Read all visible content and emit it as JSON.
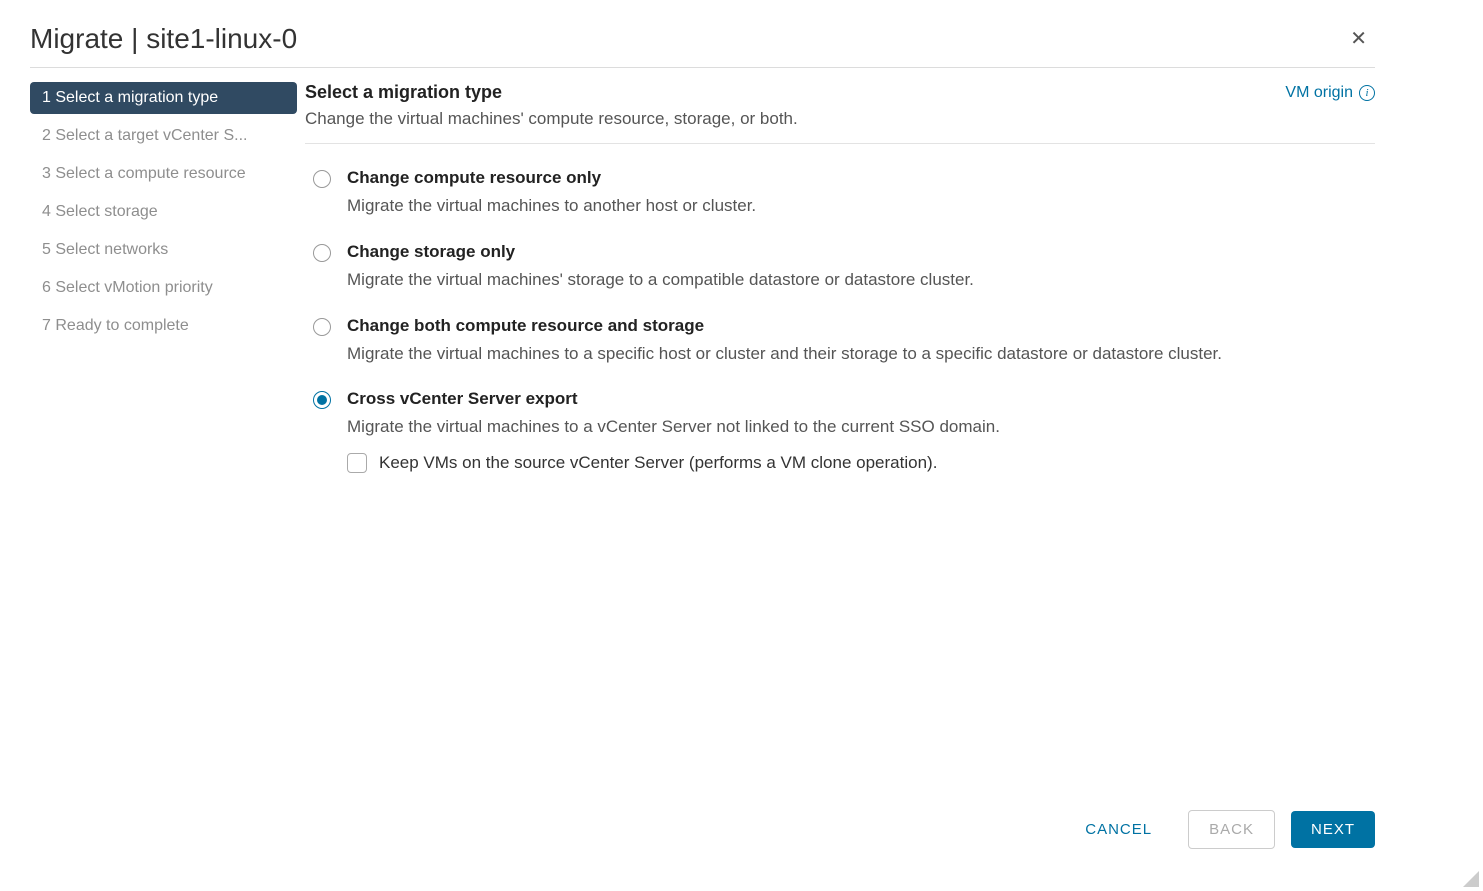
{
  "dialog": {
    "title": "Migrate | site1-linux-0"
  },
  "sidebar": {
    "steps": [
      {
        "num": "1",
        "label": "Select a migration type",
        "active": true
      },
      {
        "num": "2",
        "label": "Select a target vCenter S...",
        "active": false
      },
      {
        "num": "3",
        "label": "Select a compute resource",
        "active": false
      },
      {
        "num": "4",
        "label": "Select storage",
        "active": false
      },
      {
        "num": "5",
        "label": "Select networks",
        "active": false
      },
      {
        "num": "6",
        "label": "Select vMotion priority",
        "active": false
      },
      {
        "num": "7",
        "label": "Ready to complete",
        "active": false
      }
    ]
  },
  "main": {
    "title": "Select a migration type",
    "subtitle": "Change the virtual machines' compute resource, storage, or both.",
    "vm_origin_label": "VM origin"
  },
  "options": [
    {
      "title": "Change compute resource only",
      "desc": "Migrate the virtual machines to another host or cluster.",
      "selected": false
    },
    {
      "title": "Change storage only",
      "desc": "Migrate the virtual machines' storage to a compatible datastore or datastore cluster.",
      "selected": false
    },
    {
      "title": "Change both compute resource and storage",
      "desc": "Migrate the virtual machines to a specific host or cluster and their storage to a specific datastore or datastore cluster.",
      "selected": false
    },
    {
      "title": "Cross vCenter Server export",
      "desc": "Migrate the virtual machines to a vCenter Server not linked to the current SSO domain.",
      "selected": true,
      "checkbox_label": "Keep VMs on the source vCenter Server (performs a VM clone operation)."
    }
  ],
  "footer": {
    "cancel": "CANCEL",
    "back": "BACK",
    "next": "NEXT"
  }
}
